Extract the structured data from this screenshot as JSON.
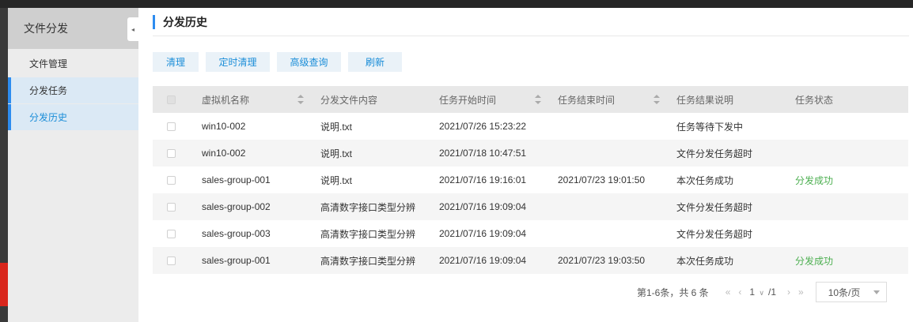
{
  "sidebar": {
    "title": "文件分发",
    "collapse_icon": "◂",
    "items": [
      {
        "label": "文件管理"
      },
      {
        "label": "分发任务"
      },
      {
        "label": "分发历史"
      }
    ]
  },
  "page": {
    "title": "分发历史"
  },
  "toolbar": {
    "clear": "清理",
    "scheduled_clear": "定时清理",
    "advanced_query": "高级查询",
    "refresh": "刷新"
  },
  "table": {
    "headers": {
      "vm_name": "虚拟机名称",
      "file_content": "分发文件内容",
      "start_time": "任务开始时间",
      "end_time": "任务结束时间",
      "result_desc": "任务结果说明",
      "status": "任务状态"
    },
    "rows": [
      {
        "vm": "win10-002",
        "file": "说明.txt",
        "start": "2021/07/26 15:23:22",
        "end": "",
        "desc": "任务等待下发中",
        "status": ""
      },
      {
        "vm": "win10-002",
        "file": "说明.txt",
        "start": "2021/07/18 10:47:51",
        "end": "",
        "desc": "文件分发任务超时",
        "status": ""
      },
      {
        "vm": "sales-group-001",
        "file": "说明.txt",
        "start": "2021/07/16 19:16:01",
        "end": "2021/07/23 19:01:50",
        "desc": "本次任务成功",
        "status": "分发成功"
      },
      {
        "vm": "sales-group-002",
        "file": "高清数字接口类型分辨",
        "start": "2021/07/16 19:09:04",
        "end": "",
        "desc": "文件分发任务超时",
        "status": ""
      },
      {
        "vm": "sales-group-003",
        "file": "高清数字接口类型分辨",
        "start": "2021/07/16 19:09:04",
        "end": "",
        "desc": "文件分发任务超时",
        "status": ""
      },
      {
        "vm": "sales-group-001",
        "file": "高清数字接口类型分辨",
        "start": "2021/07/16 19:09:04",
        "end": "2021/07/23 19:03:50",
        "desc": "本次任务成功",
        "status": "分发成功"
      }
    ]
  },
  "pagination": {
    "summary": "第1-6条，共 6 条",
    "first_icon": "«",
    "prev_icon": "‹",
    "current_page": "1",
    "page_chevron": "∨",
    "total_pages": "/1",
    "next_icon": "›",
    "last_icon": "»",
    "page_size": "10条/页"
  },
  "colors": {
    "accent": "#2d8cf0",
    "link": "#1a8dd8",
    "success": "#4caf50",
    "active_bg": "#dbe9f5"
  }
}
